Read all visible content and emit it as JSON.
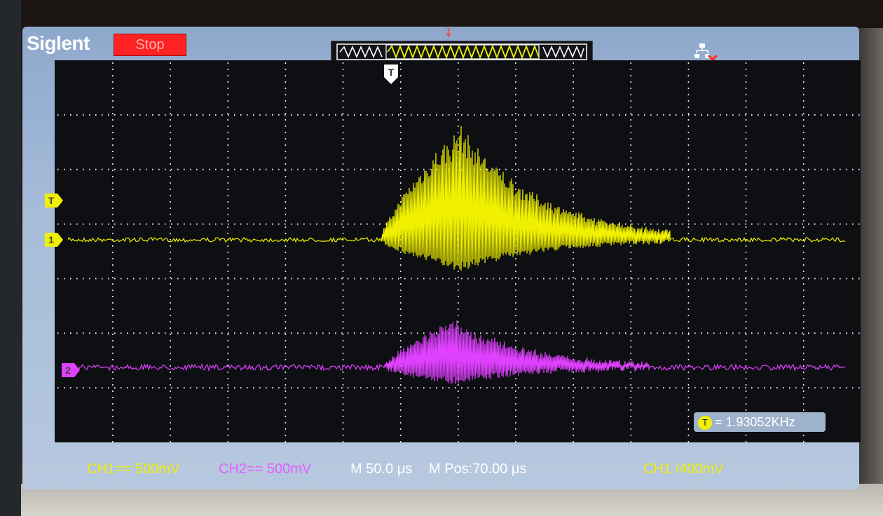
{
  "device": {
    "brand": "Siglent",
    "run_state": "Stop"
  },
  "colors": {
    "ch1": "#f0f000",
    "ch2": "#e040ff",
    "run_state_bg": "#ff2222",
    "grid": "#e8eef6",
    "screen_frame": "#9fb6d6"
  },
  "icons": {
    "trigger_top": "trigger-position-marker",
    "trigger_grid": "trigger-t-marker",
    "status": "usb-disconnected-icon"
  },
  "channel_markers": {
    "ch1_trigger_label": "T",
    "ch1_label": "1",
    "ch2_label": "2"
  },
  "trigger_marker_label": "T",
  "measurement": {
    "badge": "T",
    "frequency": "= 1.93052KHz"
  },
  "status": {
    "ch1_scale": "CH1== 500mV",
    "ch2_scale": "CH2== 500mV",
    "timebase": "M 50.0 μs",
    "horizontal_position": "M Pos:70.00 μs",
    "trigger_level": "CH1 /400mV"
  }
}
